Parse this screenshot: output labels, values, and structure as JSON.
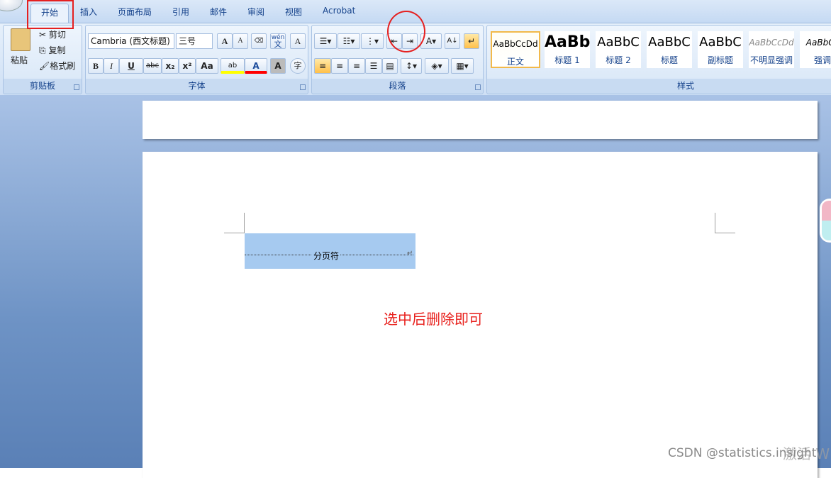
{
  "tabs": [
    "开始",
    "插入",
    "页面布局",
    "引用",
    "邮件",
    "审阅",
    "视图",
    "Acrobat"
  ],
  "clipboard": {
    "paste": "粘贴",
    "cut": "剪切",
    "copy": "复制",
    "format_painter": "格式刷",
    "label": "剪贴板"
  },
  "font": {
    "name": "Cambria (西文标题)",
    "size": "三号",
    "label": "字体",
    "grow": "A",
    "shrink": "A",
    "bold": "B",
    "italic": "I",
    "underline": "U",
    "strike": "abc",
    "sub": "x₂",
    "sup": "x²",
    "case": "Aa",
    "highlight": "ab",
    "color": "A",
    "shade": "A",
    "phonetic": "wén",
    "phonetic_char": "文",
    "enclose": "字",
    "border_char": "A"
  },
  "paragraph": {
    "label": "段落"
  },
  "styles": {
    "label": "样式",
    "items": [
      {
        "preview": "AaBbCcDd",
        "name": "正文"
      },
      {
        "preview": "AaBb",
        "name": "标题 1"
      },
      {
        "preview": "AaBbC",
        "name": "标题 2"
      },
      {
        "preview": "AaBbC",
        "name": "标题"
      },
      {
        "preview": "AaBbC",
        "name": "副标题"
      },
      {
        "preview": "AaBbCcDd",
        "name": "不明显强调"
      },
      {
        "preview": "AaBbCc",
        "name": "强调"
      }
    ]
  },
  "document": {
    "page_break": "分页符",
    "note": "选中后删除即可"
  },
  "watermark": {
    "csdn": "CSDN @statistics.insight",
    "activate": "激活 W"
  },
  "colors": {
    "highlight": "#ffff00",
    "font_color": "#ff0000",
    "annotation": "#e52020"
  }
}
